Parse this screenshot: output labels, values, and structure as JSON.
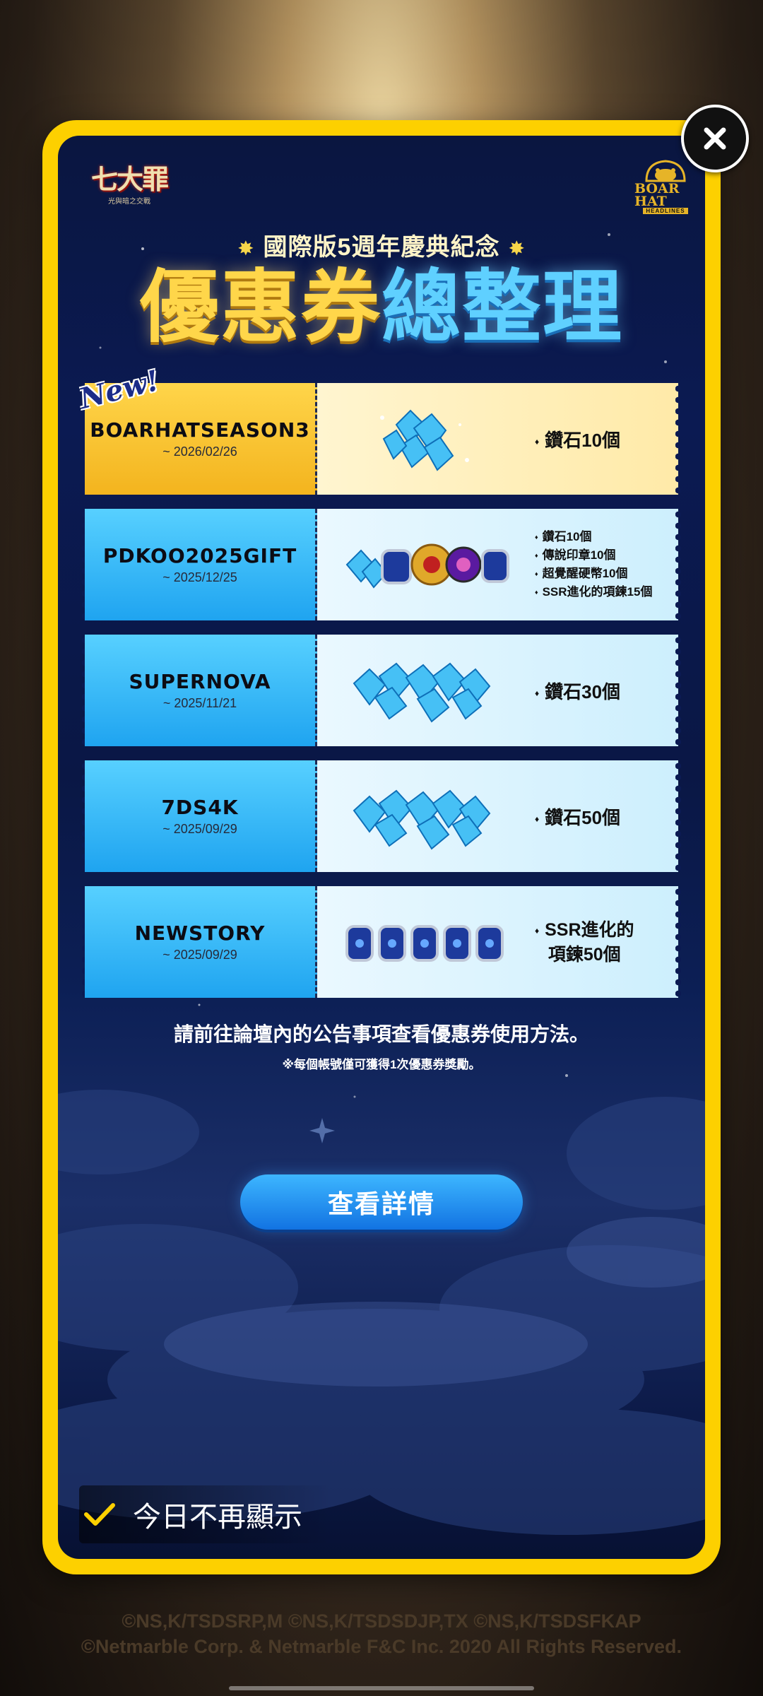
{
  "popup": {
    "game_logo": "七大罪",
    "game_logo_sub": "光與暗之交戰",
    "brand_logo": "BOAR HAT",
    "brand_logo_sub": "HEADLINES",
    "subtitle": "國際版5週年慶典紀念",
    "title_gold": "優惠券",
    "title_blue": "總整理",
    "coupons": [
      {
        "badge": "New!",
        "code": "BOARHATSEASON3",
        "date": "~ 2026/02/26",
        "style": "gold",
        "rewards": [
          "鑽石10個"
        ],
        "icon": "diamond-pile-icon"
      },
      {
        "code": "PDKOO2025GIFT",
        "date": "~ 2025/12/25",
        "style": "blue",
        "rewards": [
          "鑽石10個",
          "傳說印章10個",
          "超覺醒硬幣10個",
          "SSR進化的項鍊15個"
        ],
        "icon": "mixed-items-icon"
      },
      {
        "code": "SUPERNOVA",
        "date": "~ 2025/11/21",
        "style": "blue",
        "rewards": [
          "鑽石30個"
        ],
        "icon": "diamond-pile-icon"
      },
      {
        "code": "7DS4K",
        "date": "~ 2025/09/29",
        "style": "blue",
        "rewards": [
          "鑽石50個"
        ],
        "icon": "diamond-pile-icon"
      },
      {
        "code": "NEWSTORY",
        "date": "~ 2025/09/29",
        "style": "blue",
        "rewards_line1": "SSR進化的",
        "rewards_line2": "項鍊50個",
        "icon": "necklace-icon"
      }
    ],
    "notice_main": "請前往論壇內的公告事項查看優惠券使用方法。",
    "notice_sub": "※每個帳號僅可獲得1次優惠券獎勵。",
    "details_button": "查看詳情",
    "dont_show_today": "今日不再顯示"
  },
  "footer": {
    "line1": "©NS,K/TSDSRP,M ©NS,K/TSDSDJP,TX ©NS,K/TSDSFKAP",
    "line2": "©Netmarble Corp. & Netmarble F&C Inc. 2020 All Rights Reserved."
  },
  "colors": {
    "frame": "#fdd000",
    "button": "#1f8ef0",
    "coupon_gold": "#f3b41e",
    "coupon_blue": "#1fa4f0"
  }
}
